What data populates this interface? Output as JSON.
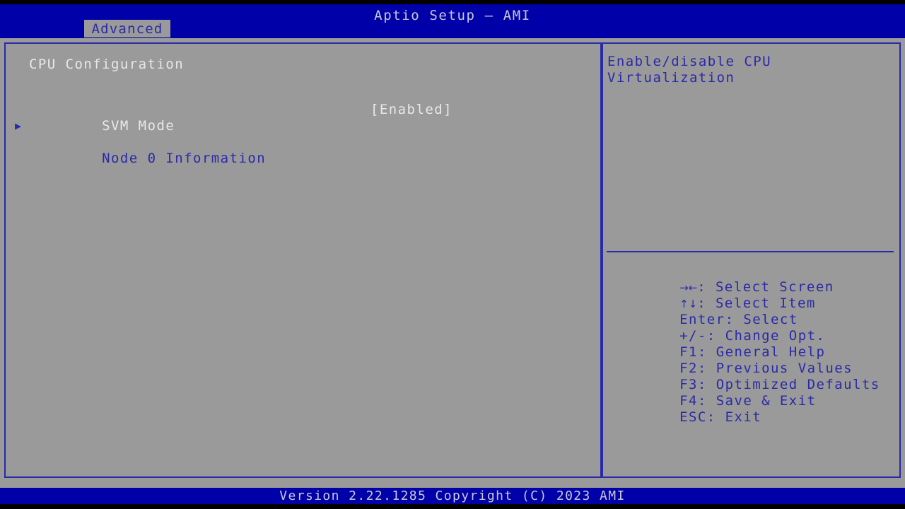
{
  "app": {
    "title": "Aptio Setup – AMI",
    "version_line": "Version 2.22.1285 Copyright (C) 2023 AMI"
  },
  "colors": {
    "background_blue": "#0000a8",
    "panel_gray": "#9a9a9a",
    "accent_blue": "#2a2aa8",
    "text_light": "#e8e8e8",
    "title_text": "#c8c8d8",
    "black": "#000000"
  },
  "tabs": [
    {
      "label": "Advanced",
      "selected": true
    }
  ],
  "left_panel": {
    "section_title": "CPU Configuration",
    "options": [
      {
        "label": "SVM Mode",
        "value": "[Enabled]",
        "type": "option",
        "selected": true
      },
      {
        "label": "Node 0 Information",
        "value": "",
        "type": "submenu",
        "bullet": "submenu-arrow-icon",
        "selected": false
      }
    ]
  },
  "right_panel": {
    "help_text": "Enable/disable CPU\nVirtualization",
    "keys": [
      {
        "glyph": "→←",
        "key": "",
        "separator": ": ",
        "action": "Select Screen",
        "icon": "left-right-arrow-icon"
      },
      {
        "glyph": "↑↓",
        "key": "",
        "separator": ": ",
        "action": "Select Item",
        "icon": "up-down-arrow-icon"
      },
      {
        "glyph": "",
        "key": "Enter",
        "separator": ": ",
        "action": "Select",
        "icon": ""
      },
      {
        "glyph": "",
        "key": "+/-",
        "separator": ": ",
        "action": "Change Opt.",
        "icon": ""
      },
      {
        "glyph": "",
        "key": "F1",
        "separator": ": ",
        "action": "General Help",
        "icon": ""
      },
      {
        "glyph": "",
        "key": "F2",
        "separator": ": ",
        "action": "Previous Values",
        "icon": ""
      },
      {
        "glyph": "",
        "key": "F3",
        "separator": ": ",
        "action": "Optimized Defaults",
        "icon": ""
      },
      {
        "glyph": "",
        "key": "F4",
        "separator": ": ",
        "action": "Save & Exit",
        "icon": ""
      },
      {
        "glyph": "",
        "key": "ESC",
        "separator": ": ",
        "action": "Exit",
        "icon": ""
      }
    ]
  }
}
